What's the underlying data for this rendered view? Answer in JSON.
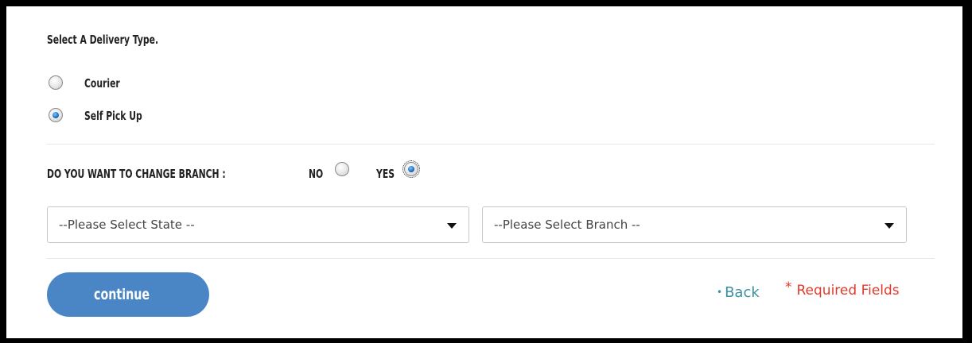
{
  "delivery": {
    "heading": "Select A Delivery Type.",
    "options": [
      {
        "label": "Courier",
        "checked": false
      },
      {
        "label": "Self Pick Up",
        "checked": true
      }
    ]
  },
  "branch_change": {
    "question": "DO YOU WANT TO CHANGE BRANCH :",
    "no_label": "NO",
    "yes_label": "YES",
    "selected": "YES"
  },
  "selects": {
    "state_placeholder": "--Please Select State --",
    "branch_placeholder": "--Please Select Branch --"
  },
  "footer": {
    "continue_label": "continue",
    "back_bullet": "•",
    "back_label": "Back",
    "required_star": "*",
    "required_label": "Required Fields"
  },
  "colors": {
    "button_blue": "#4a86c5",
    "link_teal": "#3a8fa0",
    "required_red": "#e03a2a",
    "radio_checked": "#1a6cc0"
  },
  "icons": {
    "dropdown": "chevron-down-icon"
  }
}
